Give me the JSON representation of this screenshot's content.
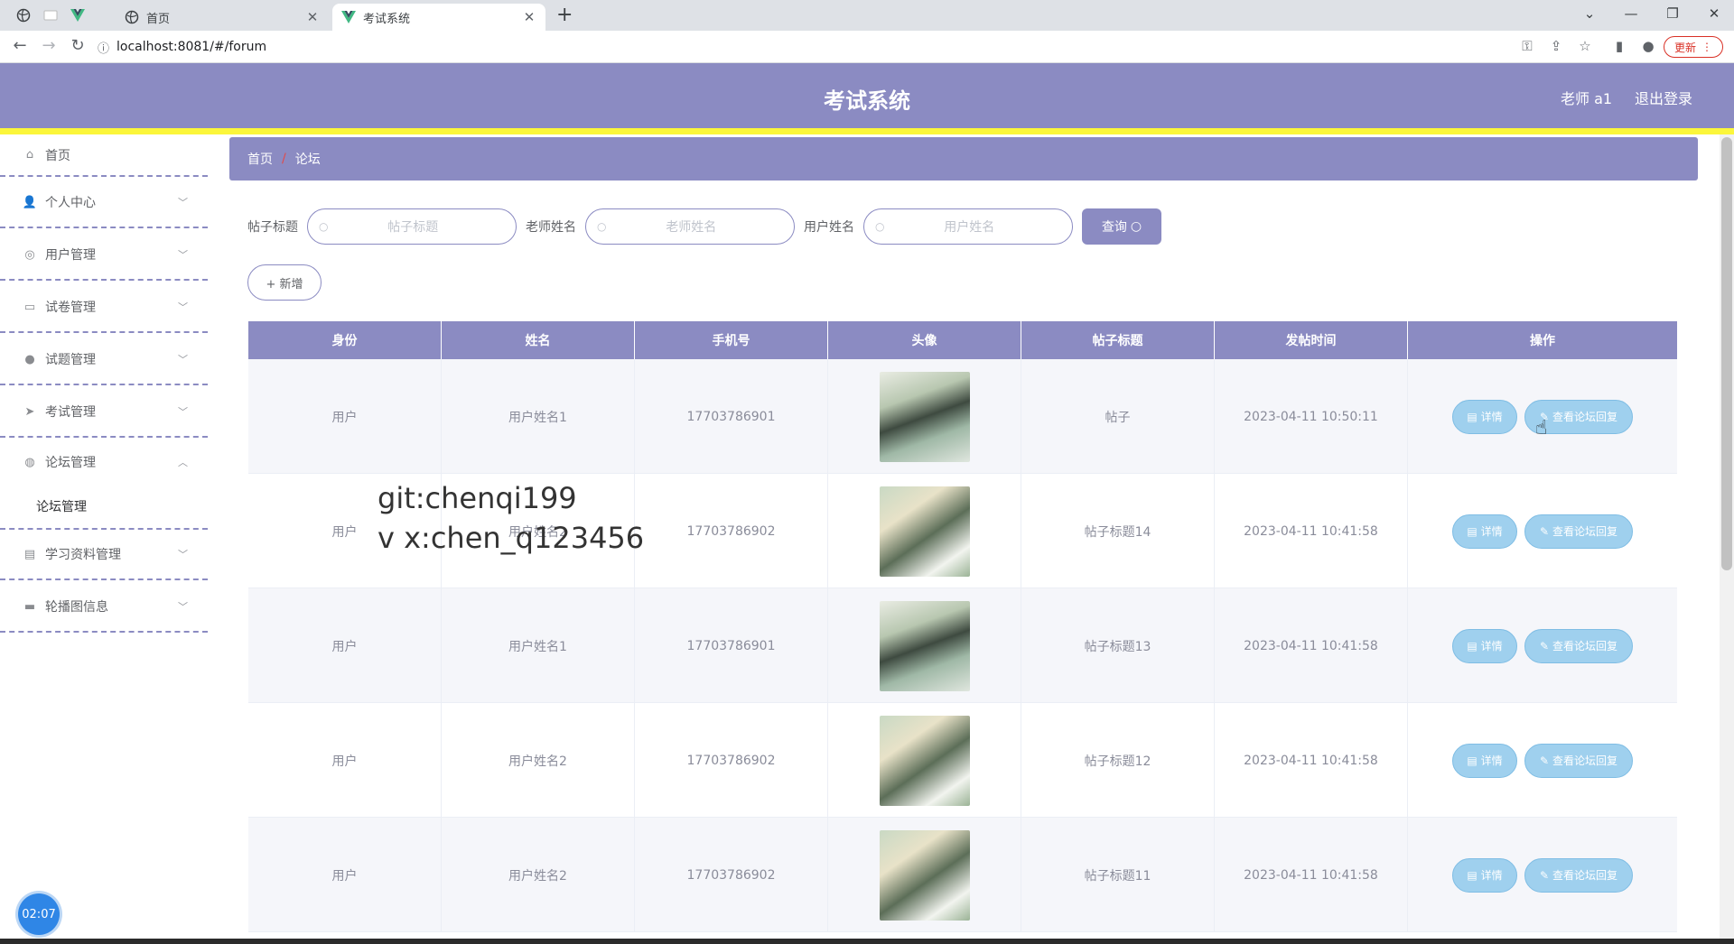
{
  "browser": {
    "tabs": [
      {
        "title": "首页"
      },
      {
        "title": "考试系统"
      }
    ],
    "url": "localhost:8081/#/forum",
    "update_label": "更新"
  },
  "app": {
    "title": "考试系统",
    "user": "老师 a1",
    "logout": "退出登录"
  },
  "sidebar": {
    "items": [
      {
        "label": "首页",
        "icon": "home-icon"
      },
      {
        "label": "个人中心",
        "icon": "user-icon"
      },
      {
        "label": "用户管理",
        "icon": "compass-icon"
      },
      {
        "label": "试卷管理",
        "icon": "document-icon"
      },
      {
        "label": "试题管理",
        "icon": "lightbulb-icon"
      },
      {
        "label": "考试管理",
        "icon": "send-icon"
      },
      {
        "label": "论坛管理",
        "icon": "globe-icon"
      },
      {
        "label": "学习资料管理",
        "icon": "chat-icon"
      },
      {
        "label": "轮播图信息",
        "icon": "briefcase-icon"
      }
    ],
    "submenu": {
      "label": "论坛管理"
    },
    "clock": "02:07"
  },
  "breadcrumb": {
    "home": "首页",
    "sep": "/",
    "current": "论坛"
  },
  "search": {
    "title_label": "帖子标题",
    "title_placeholder": "帖子标题",
    "teacher_label": "老师姓名",
    "teacher_placeholder": "老师姓名",
    "user_label": "用户姓名",
    "user_placeholder": "用户姓名",
    "query_label": "查询"
  },
  "add_label": "+ 新增",
  "table": {
    "columns": [
      "身份",
      "姓名",
      "手机号",
      "头像",
      "帖子标题",
      "发帖时间",
      "操作"
    ],
    "rows": [
      {
        "role": "用户",
        "name": "用户姓名1",
        "phone": "17703786901",
        "avatar": "a",
        "title": "帖子",
        "time": "2023-04-11 10:50:11"
      },
      {
        "role": "用户",
        "name": "用户姓名2",
        "phone": "17703786902",
        "avatar": "b",
        "title": "帖子标题14",
        "time": "2023-04-11 10:41:58"
      },
      {
        "role": "用户",
        "name": "用户姓名1",
        "phone": "17703786901",
        "avatar": "a",
        "title": "帖子标题13",
        "time": "2023-04-11 10:41:58"
      },
      {
        "role": "用户",
        "name": "用户姓名2",
        "phone": "17703786902",
        "avatar": "b",
        "title": "帖子标题12",
        "time": "2023-04-11 10:41:58"
      },
      {
        "role": "用户",
        "name": "用户姓名2",
        "phone": "17703786902",
        "avatar": "b",
        "title": "帖子标题11",
        "time": "2023-04-11 10:41:58"
      }
    ],
    "detail_label": "详情",
    "reply_label": "查看论坛回复"
  },
  "watermark": {
    "line1": "git:chenqi199",
    "line2": "v x:chen_q123456"
  },
  "colors": {
    "primary": "#8b8bc2",
    "accent_yellow": "#fbf63b",
    "op_button": "#9fd0ee"
  }
}
